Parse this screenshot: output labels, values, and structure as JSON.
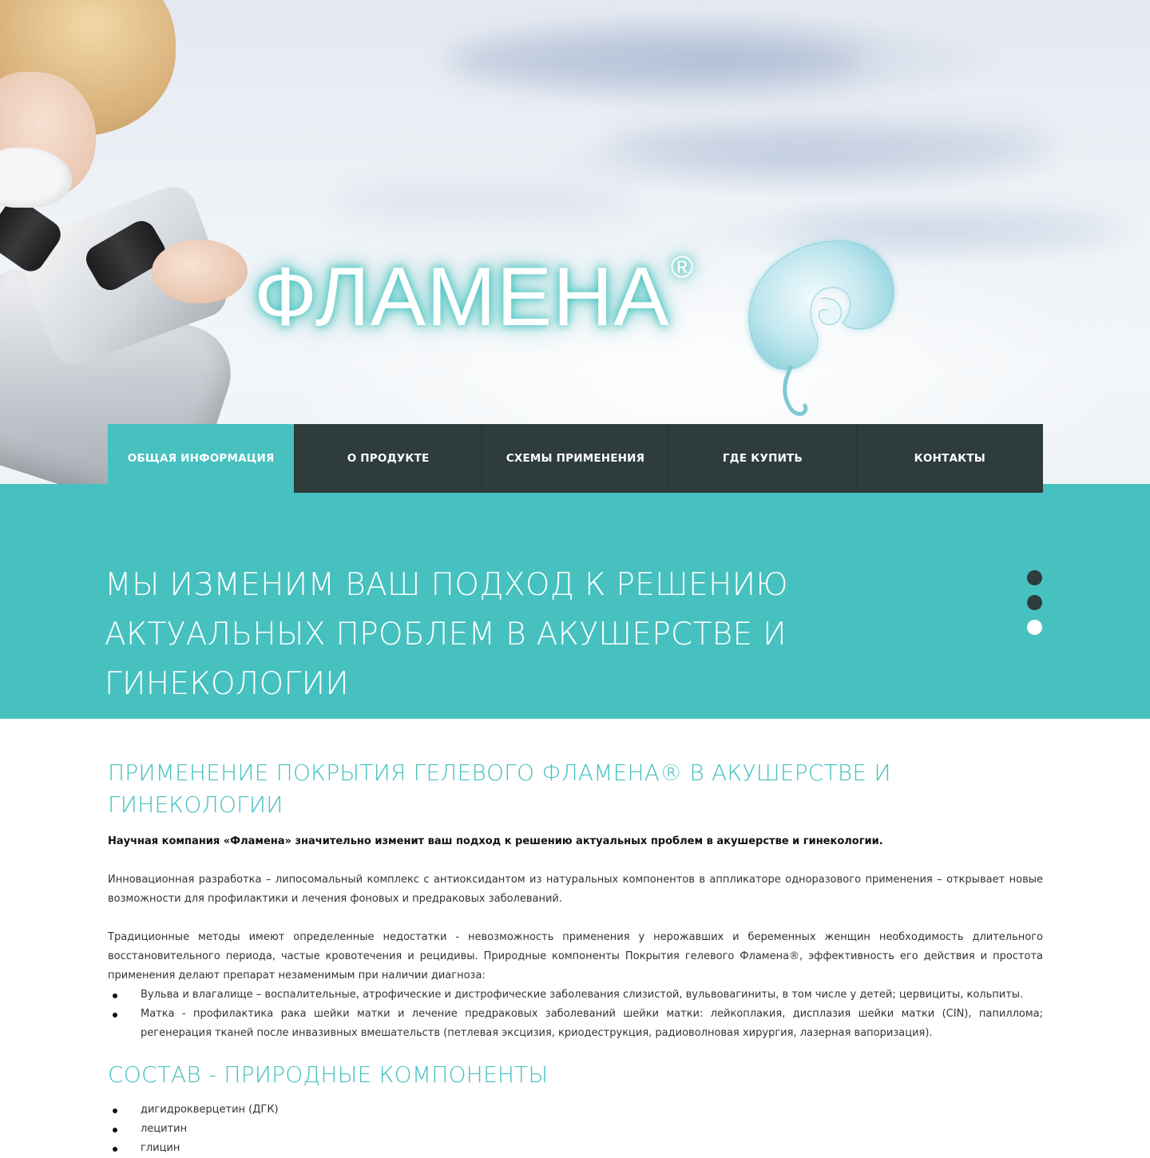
{
  "brand": {
    "name": "ФЛАМЕНА",
    "registered_mark": "®",
    "accent_color": "#46c1bf",
    "dark_color": "#2e3c3c"
  },
  "nav": {
    "items": [
      {
        "label": "ОБЩАЯ ИНФОРМАЦИЯ",
        "active": true
      },
      {
        "label": "О ПРОДУКТЕ",
        "active": false
      },
      {
        "label": "СХЕМЫ ПРИМЕНЕНИЯ",
        "active": false
      },
      {
        "label": "ГДЕ КУПИТЬ",
        "active": false
      },
      {
        "label": "КОНТАКТЫ",
        "active": false
      }
    ]
  },
  "slider": {
    "text": "МЫ ИЗМЕНИМ ВАШ ПОДХОД К РЕШЕНИЮ АКТУАЛЬНЫХ ПРОБЛЕМ В АКУШЕРСТВЕ И ГИНЕКОЛОГИИ",
    "slide_count": 3,
    "active_slide": 3
  },
  "content": {
    "title": "ПРИМЕНЕНИЕ ПОКРЫТИЯ ГЕЛЕВОГО ФЛАМЕНА® В АКУШЕРСТВЕ И ГИНЕКОЛОГИИ",
    "lead": "Научная компания «Фламена» значительно изменит ваш подход к решению актуальных проблем в акушерстве и гинекологии.",
    "paragraph_1": "Инновационная разработка – липосомальный комплекс с антиоксидантом из натуральных компонентов в аппликаторе одноразового применения – открывает новые возможности для профилактики и лечения фоновых и предраковых заболеваний.",
    "paragraph_2": "Традиционные методы имеют определенные недостатки - невозможность применения у нерожавших и беременных женщин необходимость длительного восстановительного периода, частые кровотечения и рецидивы. Природные компоненты Покрытия гелевого Фламена®, эффективность его действия и простота применения делают препарат незаменимым при наличии диагноза:",
    "indications": [
      "Вульва и влагалище – воспалительные, атрофические и дистрофические заболевания слизистой, вульвовагиниты, в том числе у детей; цервициты, кольпиты.",
      "Матка - профилактика рака шейки матки и лечение предраковых заболеваний шейки матки: лейкоплакия, дисплазия шейки матки (CIN), папиллома; регенерация тканей после инвазивных вмешательств (петлевая эксцизия, криодеструкция, радиоволновая хирургия, лазерная вапоризация)."
    ],
    "composition_title": "СОСТАВ - ПРИРОДНЫЕ КОМПОНЕНТЫ",
    "composition": [
      "дигидрокверцетин (ДГК)",
      "лецитин",
      "глицин"
    ]
  },
  "icons": {
    "logo": "calla-lily-flower-icon"
  }
}
